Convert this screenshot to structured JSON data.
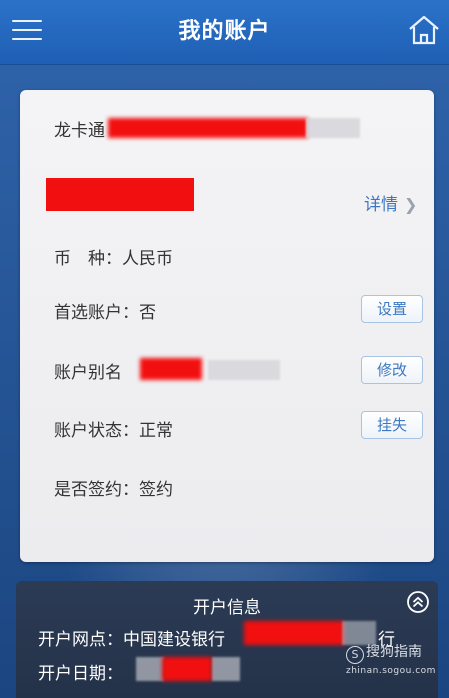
{
  "header": {
    "title": "我的账户"
  },
  "account": {
    "card_label": "龙卡通",
    "detail_label": "详情",
    "currency_label": "币　种：",
    "currency_value": "人民币",
    "preferred_label": "首选账户：",
    "preferred_value": "否",
    "preferred_button": "设置",
    "alias_label": "账户别名",
    "alias_button": "修改",
    "status_label": "账户状态：",
    "status_value": "正常",
    "status_button": "挂失",
    "signed_label": "是否签约：",
    "signed_value": "签约"
  },
  "open_info": {
    "title": "开户信息",
    "branch_label": "开户网点：",
    "branch_value_prefix": "中国建设银行",
    "branch_value_suffix": "行",
    "date_label": "开户日期："
  },
  "watermark": {
    "text": "搜狗指南",
    "url": "zhinan.sogou.com"
  },
  "colors": {
    "accent": "#3c77c4",
    "header": "#1f5fb4",
    "redaction": "#f20f0f"
  },
  "icons": [
    "menu-icon",
    "home-icon",
    "chevron-right-icon",
    "collapse-up-icon",
    "sogou-logo-icon"
  ]
}
